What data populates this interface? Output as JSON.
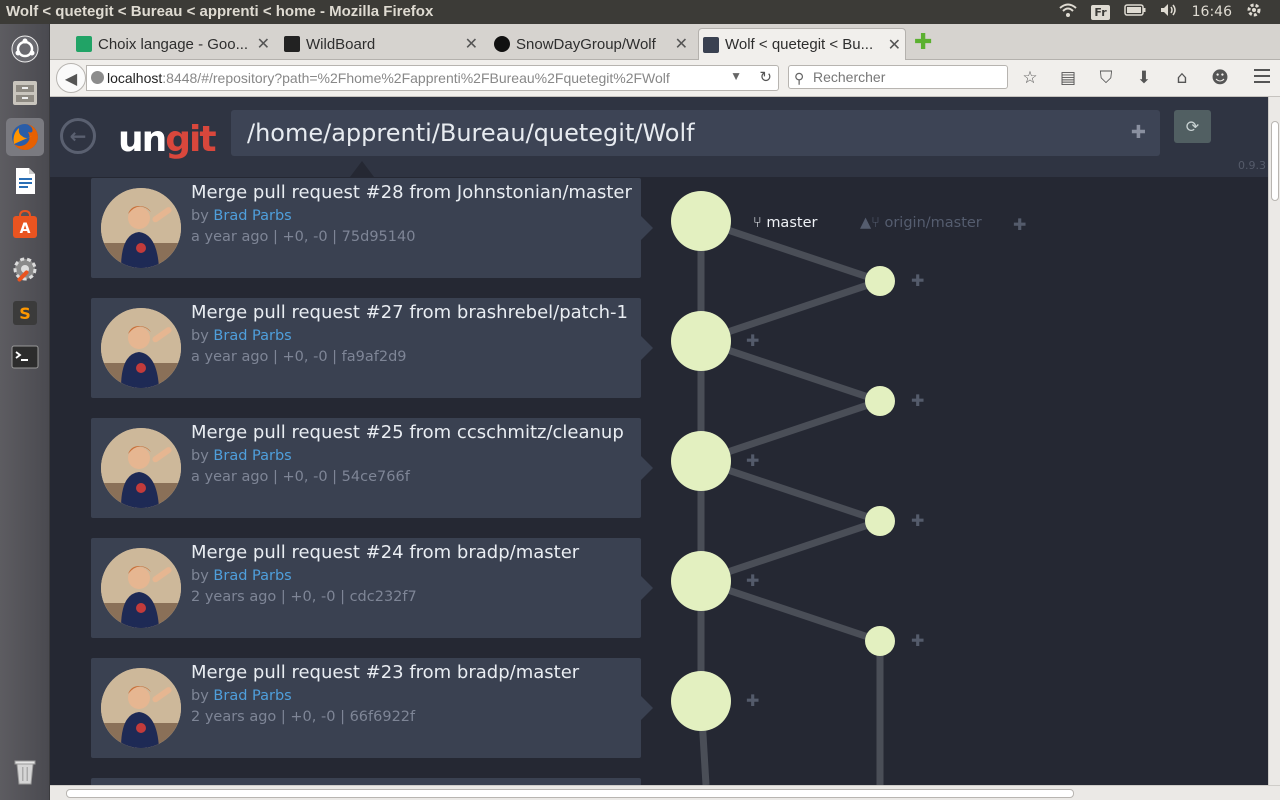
{
  "window_title": "Wolf < quetegit < Bureau < apprenti < home - Mozilla Firefox",
  "panel": {
    "keyboard": "Fr",
    "clock": "16:46"
  },
  "tabs": [
    {
      "label": "Choix langage - Goo...",
      "favicon_color": "#21a366"
    },
    {
      "label": "WildBoard",
      "favicon_color": "#222222"
    },
    {
      "label": "SnowDayGroup/Wolf",
      "favicon_color": "#111111"
    },
    {
      "label": "Wolf < quetegit < Bu...",
      "favicon_color": "#3a4151"
    }
  ],
  "nav": {
    "url_host": "localhost",
    "url_rest": ":8448/#/repository?path=%2Fhome%2Fapprenti%2FBureau%2Fquetegit%2FWolf",
    "search_placeholder": "Rechercher"
  },
  "ungit": {
    "logo_un": "un",
    "logo_git": "git",
    "repo_path": "/home/apprenti/Bureau/quetegit/Wolf",
    "version": "0.9.3"
  },
  "refs": {
    "master": "master",
    "origin": "origin/master"
  },
  "commits": [
    {
      "message": "Merge pull request #28 from Johnstonian/master",
      "by": "by",
      "author": "Brad Parbs",
      "meta": "a year ago | +0, -0 | 75d95140"
    },
    {
      "message": "Merge pull request #27 from brashrebel/patch-1",
      "by": "by",
      "author": "Brad Parbs",
      "meta": "a year ago | +0, -0 | fa9af2d9"
    },
    {
      "message": "Merge pull request #25 from ccschmitz/cleanup",
      "by": "by",
      "author": "Brad Parbs",
      "meta": "a year ago | +0, -0 | 54ce766f"
    },
    {
      "message": "Merge pull request #24 from bradp/master",
      "by": "by",
      "author": "Brad Parbs",
      "meta": "2 years ago | +0, -0 | cdc232f7"
    },
    {
      "message": "Merge pull request #23 from bradp/master",
      "by": "by",
      "author": "Brad Parbs",
      "meta": "2 years ago | +0, -0 | 66f6922f"
    }
  ],
  "colors": {
    "node": "#e3f0c0",
    "edge": "#4a4e57",
    "accent_git": "#d9473c",
    "author_link": "#4f9fdc"
  }
}
